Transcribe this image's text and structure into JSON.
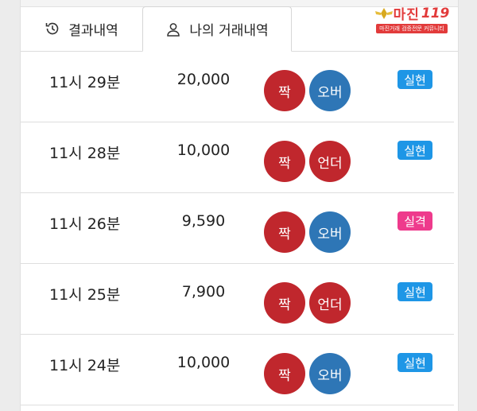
{
  "tabs": [
    {
      "label": "결과내역",
      "icon": "history-icon"
    },
    {
      "label": "나의 거래내역",
      "icon": "user-icon"
    }
  ],
  "watermark": {
    "name": "마진",
    "number": "119",
    "tagline": "마진거래 검증전문 커뮤니티"
  },
  "colors": {
    "red": "#c0272d",
    "blue": "#2e76b6",
    "win": "#1e96e6",
    "lose": "#ee3a8c"
  },
  "rows": [
    {
      "time": "11시 29분",
      "amount": "20,000",
      "pick1": "짝",
      "pick2": "오버",
      "result": "실현"
    },
    {
      "time": "11시 28분",
      "amount": "10,000",
      "pick1": "짝",
      "pick2": "언더",
      "result": "실현"
    },
    {
      "time": "11시 26분",
      "amount": "9,590",
      "pick1": "짝",
      "pick2": "오버",
      "result": "실격"
    },
    {
      "time": "11시 25분",
      "amount": "7,900",
      "pick1": "짝",
      "pick2": "언더",
      "result": "실현"
    },
    {
      "time": "11시 24분",
      "amount": "10,000",
      "pick1": "짝",
      "pick2": "오버",
      "result": "실현"
    }
  ]
}
